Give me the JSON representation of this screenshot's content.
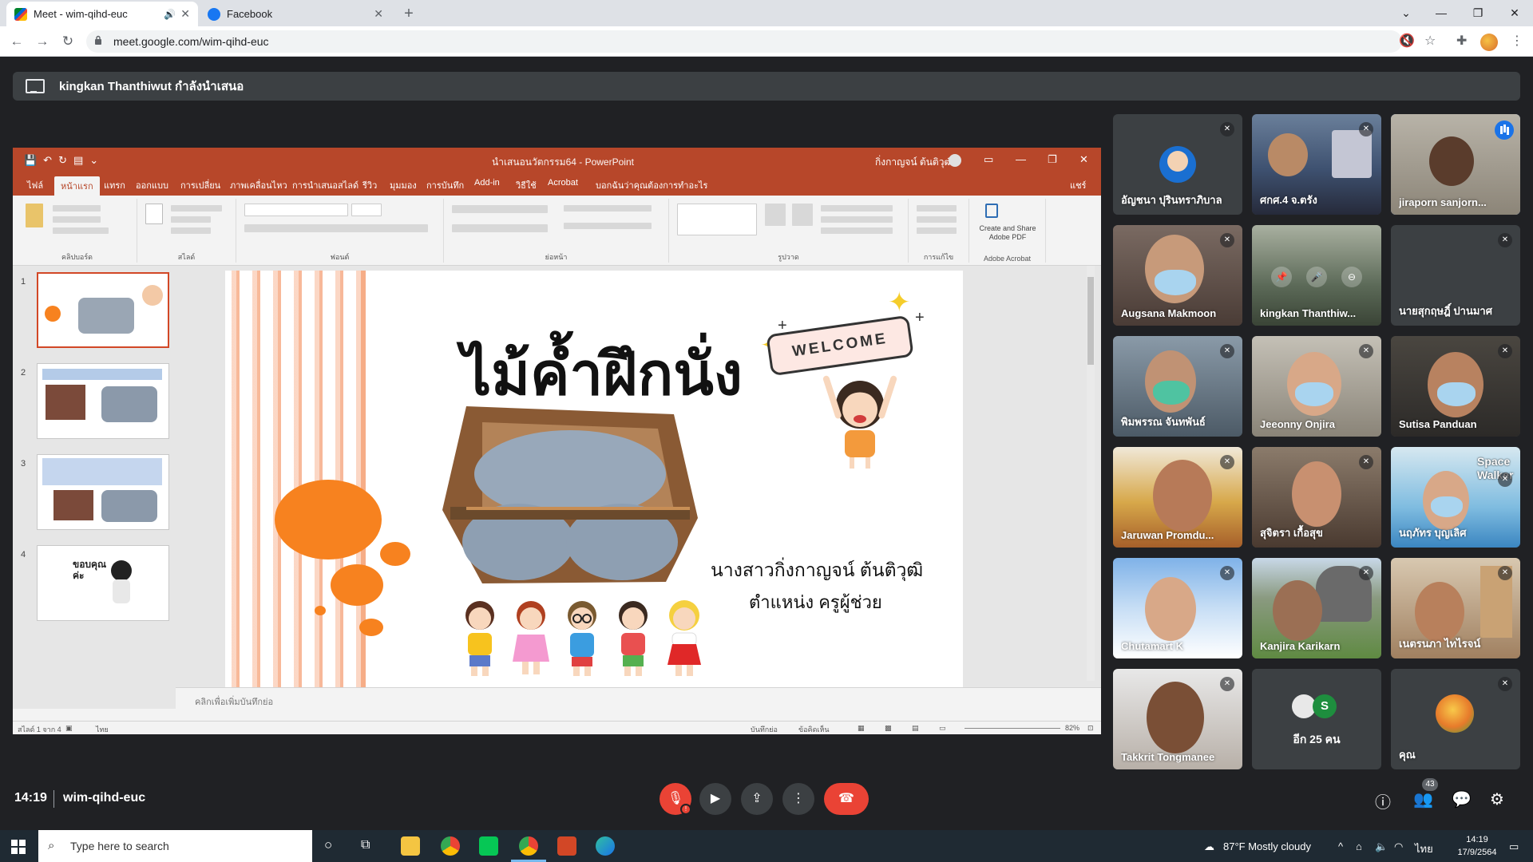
{
  "browser": {
    "tabs": [
      {
        "title": "Meet - wim-qihd-euc",
        "active": true
      },
      {
        "title": "Facebook",
        "active": false
      }
    ],
    "url": "meet.google.com/wim-qihd-euc"
  },
  "presenter": {
    "text": "kingkan Thanthiwut กำลังนำเสนอ"
  },
  "powerpoint": {
    "doc_title": "นำเสนอนวัตกรรม64 - PowerPoint",
    "user": "กิ่งกาญจน์ ต้นติวุฒิ",
    "tabs": [
      "ไฟล์",
      "หน้าแรก",
      "แทรก",
      "ออกแบบ",
      "การเปลี่ยน",
      "ภาพเคลื่อนไหว",
      "การนำเสนอสไลด์",
      "รีวิว",
      "มุมมอง",
      "การบันทึก",
      "Add-in",
      "วิธีใช้",
      "Acrobat",
      "บอกฉันว่าคุณต้องการทำอะไร"
    ],
    "share": "แชร์",
    "ribbon_groups": [
      "คลิปบอร์ด",
      "สไลด์",
      "ฟอนต์",
      "ย่อหน้า",
      "รูปวาด",
      "การแก้ไข",
      "Adobe Acrobat"
    ],
    "adobe_btn": "Create and Share Adobe PDF",
    "slide_numbers": [
      "1",
      "2",
      "3",
      "4"
    ],
    "slide": {
      "title": "ไม้ค้ำฝึกนั่ง",
      "welcome": "WELCOME",
      "author": "นางสาวกิ่งกาญจน์  ต้นติวุฒิ",
      "position": "ตำแหน่ง ครูผู้ช่วย"
    },
    "thumb4_text": "ขอบคุณค่ะ",
    "notes_placeholder": "คลิกเพื่อเพิ่มบันทึกย่อ",
    "status": {
      "slide_count": "สไลด์ 1 จาก 4",
      "lang": "ไทย",
      "notes": "บันทึกย่อ",
      "comments": "ข้อคิดเห็น",
      "zoom": "82%"
    }
  },
  "participants": [
    {
      "name": "อัญชนา ปุรินทราภิบาล",
      "muted": true
    },
    {
      "name": "ศกศ.4 จ.ตรัง",
      "muted": true
    },
    {
      "name": "jiraporn sanjorn...",
      "muted": false,
      "speaking": true
    },
    {
      "name": "Augsana Makmoon",
      "muted": true
    },
    {
      "name": "kingkan Thanthiw...",
      "muted": false
    },
    {
      "name": "นายสุกฤษฎิ์ ปานมาศ",
      "muted": true
    },
    {
      "name": "พิมพรรณ จันทพันธ์",
      "muted": true
    },
    {
      "name": "Jeeonny Onjira",
      "muted": true
    },
    {
      "name": "Sutisa Panduan",
      "muted": true
    },
    {
      "name": "Jaruwan Promdu...",
      "muted": true
    },
    {
      "name": "สุจิตรา เกื้อสุข",
      "muted": true
    },
    {
      "name": "นฤภัทร บุญเลิศ",
      "muted": true
    },
    {
      "name": "Chutamart K",
      "muted": true
    },
    {
      "name": "Kanjira Karikarn",
      "muted": true
    },
    {
      "name": "เนตรนภา ไทไรจน์",
      "muted": true
    },
    {
      "name": "Takkrit Tongmanee",
      "muted": true
    },
    {
      "name": "อีก 25 คน",
      "muted": false
    },
    {
      "name": "คุณ",
      "muted": true
    }
  ],
  "space_walker_text": "Space Walker",
  "more_avatar_letter": "S",
  "meeting": {
    "time": "14:19",
    "code": "wim-qihd-euc",
    "people_count": "43"
  },
  "taskbar": {
    "search_placeholder": "Type here to search",
    "weather": "87°F  Mostly cloudy",
    "lang": "ไทย",
    "time": "14:19",
    "date": "17/9/2564"
  }
}
